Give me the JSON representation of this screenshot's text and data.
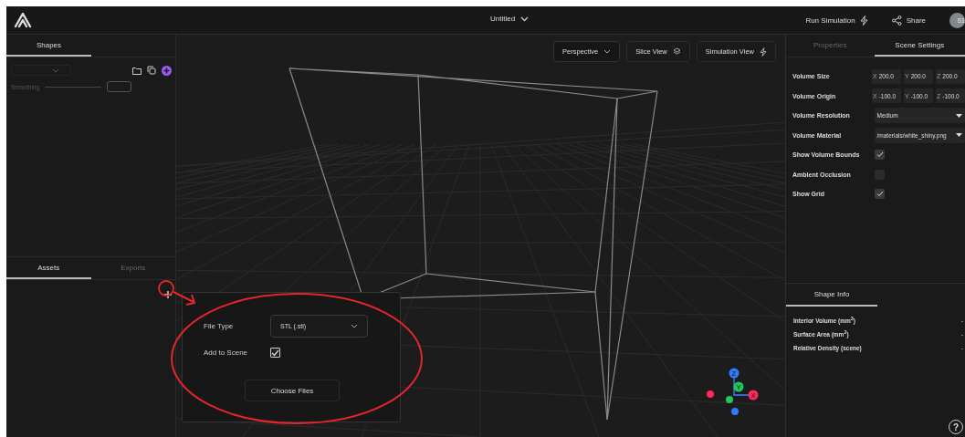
{
  "topbar": {
    "title": "Untitled",
    "actions": [
      {
        "label": "Run Simulation",
        "kind": "bolt"
      },
      {
        "label": "Share",
        "kind": "share"
      }
    ],
    "avatar": "S1"
  },
  "left_panel": {
    "tabs": [
      {
        "label": "Shapes",
        "selected": true
      }
    ],
    "smoothing_label": "Smoothing",
    "bottom_tabs": [
      {
        "label": "Assets",
        "selected": true
      },
      {
        "label": "Exports",
        "selected": false
      }
    ]
  },
  "viewport": {
    "buttons": [
      {
        "label": "Perspective",
        "kind": "dropdown"
      },
      {
        "label": "Slice View",
        "kind": "layers"
      },
      {
        "label": "Simulation View",
        "kind": "bolt"
      }
    ],
    "gizmo": [
      {
        "label": "Z",
        "color": "#2f7bff"
      },
      {
        "label": "Y",
        "color": "#22c55e"
      },
      {
        "label": "X",
        "color": "#ff2a5a"
      }
    ]
  },
  "right_panel": {
    "tabs": [
      {
        "label": "Properties",
        "selected": false
      },
      {
        "label": "Scene Settings",
        "selected": true
      }
    ],
    "settings": [
      {
        "label": "Volume Size",
        "kind": "xyz",
        "values": [
          {
            "axis": "X",
            "value": "200.0"
          },
          {
            "axis": "Y",
            "value": "200.0"
          },
          {
            "axis": "Z",
            "value": "200.0"
          }
        ]
      },
      {
        "label": "Volume Origin",
        "kind": "xyz",
        "values": [
          {
            "axis": "X",
            "value": "-100.0"
          },
          {
            "axis": "Y",
            "value": "-100.0"
          },
          {
            "axis": "Z",
            "value": "-100.0"
          }
        ]
      },
      {
        "label": "Volume Resolution",
        "kind": "select",
        "value": "Medium"
      },
      {
        "label": "Volume Material",
        "kind": "select",
        "value": "/materials/white_shiny.png"
      },
      {
        "label": "Show Volume Bounds",
        "kind": "checkbox",
        "checked": true
      },
      {
        "label": "Ambient Occlusion",
        "kind": "checkbox",
        "checked": false
      },
      {
        "label": "Show Grid",
        "kind": "checkbox",
        "checked": true
      }
    ]
  },
  "shape_info": {
    "tabs": [
      {
        "label": "Shape Info",
        "selected": true
      }
    ],
    "rows": [
      {
        "label": "Interior Volume (mm$^{3}$)",
        "value": "-"
      },
      {
        "label": "Surface Area (mm$^{2}$)",
        "value": "-"
      },
      {
        "label": "Relative Density (scene)",
        "value": "-"
      }
    ],
    "help": "?"
  },
  "import_popup": {
    "file_type_label": "File Type",
    "file_type": "STL (.stl)",
    "add_to_scene_label": "Add to Scene",
    "add_to_scene": true,
    "button": "Choose Files"
  }
}
